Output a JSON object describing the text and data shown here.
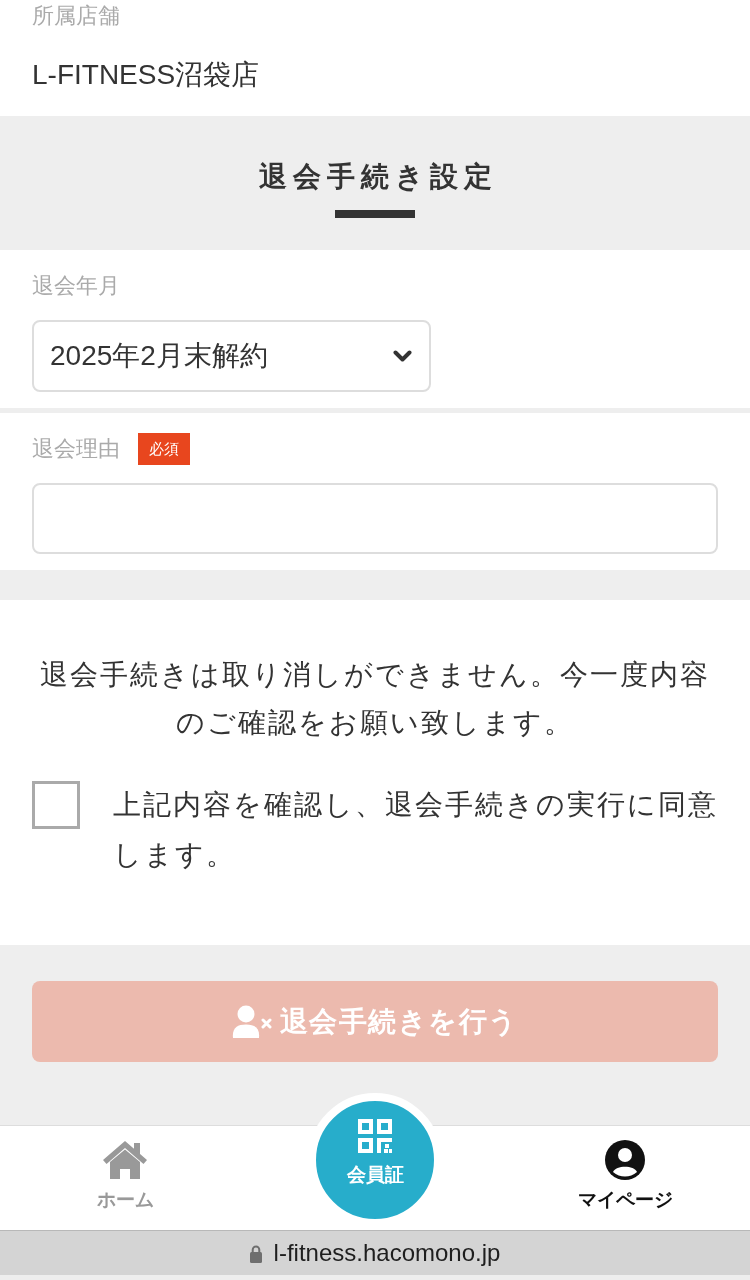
{
  "store": {
    "label": "所属店舗",
    "value": "L-FITNESS沼袋店"
  },
  "section_title": "退会手続き設定",
  "fields": [
    {
      "kind": "select",
      "label": "退会年月",
      "value": "2025年2月末解約"
    },
    {
      "kind": "text",
      "label": "退会理由",
      "badge": "必須"
    }
  ],
  "notice": "退会手続きは取り消しができません。今一度内容のご確認をお願い致します。",
  "agreement": {
    "label": "上記内容を確認し、退会手続きの実行に同意します。",
    "checked": false
  },
  "submit_button": {
    "label": "退会手続きを行う",
    "disabled": true
  },
  "bottom_nav": [
    {
      "kind": "home",
      "label": "ホーム",
      "selected": false
    },
    {
      "kind": "card",
      "label": "会員証",
      "selected": false
    },
    {
      "kind": "profile",
      "label": "マイページ",
      "selected": true
    }
  ],
  "browser_bar": {
    "url": "l-fitness.hacomono.jp"
  }
}
